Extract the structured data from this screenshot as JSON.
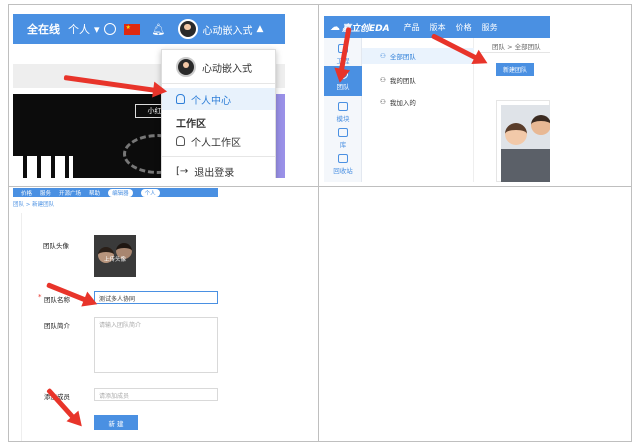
{
  "panel1": {
    "brand": "全在线",
    "nav_personal": "个人",
    "username": "心动嵌入式",
    "menu": {
      "user": "心动嵌入式",
      "personal_center": "个人中心",
      "section": "工作区",
      "personal_workspace": "个人工作区",
      "logout": "退出登录"
    },
    "bg_text": "小红书",
    "accent": "#4a90e2"
  },
  "panel2": {
    "logo": "嘉立创EDA",
    "nav": [
      "产品",
      "版本",
      "价格",
      "服务"
    ],
    "breadcrumb": "团队 > 全部团队",
    "sidebar": [
      "工程",
      "团队",
      "模块",
      "库",
      "回收站"
    ],
    "list": [
      "全部团队",
      "我的团队",
      "我加入的"
    ],
    "new_team_button": "新建团队"
  },
  "panel3": {
    "nav": [
      "价格",
      "服务",
      "开源广场",
      "帮助",
      "编辑器",
      "个人"
    ],
    "breadcrumb": "团队 > 新建团队",
    "avatar_label": "团队头像",
    "upload_text": "上传头像",
    "name_label": "团队名称",
    "name_value": "测试多人协同",
    "intro_label": "团队简介",
    "intro_placeholder": "请输入团队简介",
    "members_label": "添加成员",
    "members_placeholder": "请添加成员",
    "create_button": "新 建"
  }
}
